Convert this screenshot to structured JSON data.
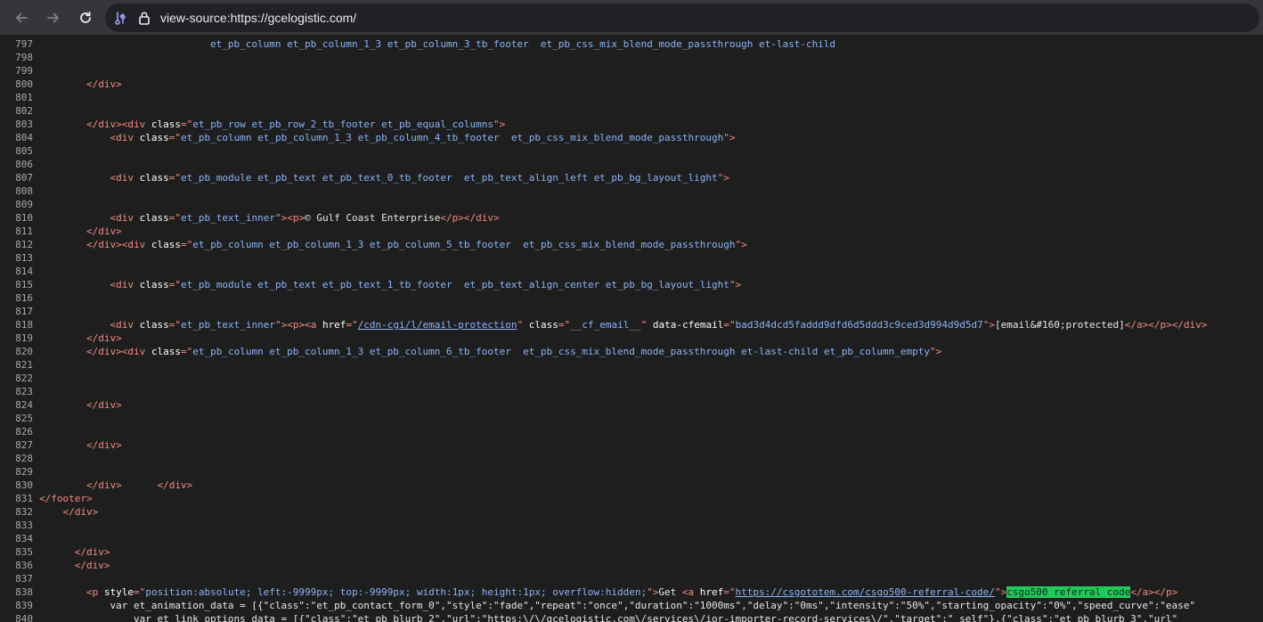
{
  "toolbar": {
    "url": "view-source:https://gcelogistic.com/",
    "buttons": [
      "back",
      "forward",
      "reload"
    ]
  },
  "source": {
    "lines": [
      {
        "n": "797",
        "t": [
          [
            "                             ",
            ""
          ],
          [
            "et_pb_column et_pb_column_1_3 et_pb_column_3_tb_footer  et_pb_css_mix_blend_mode_passthrough et-last-child",
            "v"
          ]
        ]
      },
      {
        "n": "798",
        "t": []
      },
      {
        "n": "799",
        "t": []
      },
      {
        "n": "800",
        "t": [
          [
            "        ",
            ""
          ],
          [
            "</div>",
            "t"
          ]
        ]
      },
      {
        "n": "801",
        "t": []
      },
      {
        "n": "802",
        "t": []
      },
      {
        "n": "803",
        "t": [
          [
            "        ",
            ""
          ],
          [
            "</div><div ",
            "t"
          ],
          [
            "class",
            "a"
          ],
          [
            "=\"",
            "t"
          ],
          [
            "et_pb_row et_pb_row_2_tb_footer et_pb_equal_columns",
            "v"
          ],
          [
            "\">",
            "t"
          ]
        ]
      },
      {
        "n": "804",
        "t": [
          [
            "            ",
            ""
          ],
          [
            "<div ",
            "t"
          ],
          [
            "class",
            "a"
          ],
          [
            "=\"",
            "t"
          ],
          [
            "et_pb_column et_pb_column_1_3 et_pb_column_4_tb_footer  et_pb_css_mix_blend_mode_passthrough",
            "v"
          ],
          [
            "\">",
            "t"
          ]
        ]
      },
      {
        "n": "805",
        "t": []
      },
      {
        "n": "806",
        "t": []
      },
      {
        "n": "807",
        "t": [
          [
            "            ",
            ""
          ],
          [
            "<div ",
            "t"
          ],
          [
            "class",
            "a"
          ],
          [
            "=\"",
            "t"
          ],
          [
            "et_pb_module et_pb_text et_pb_text_0_tb_footer  et_pb_text_align_left et_pb_bg_layout_light",
            "v"
          ],
          [
            "\">",
            "t"
          ]
        ]
      },
      {
        "n": "808",
        "t": []
      },
      {
        "n": "809",
        "t": []
      },
      {
        "n": "810",
        "t": [
          [
            "            ",
            ""
          ],
          [
            "<div ",
            "t"
          ],
          [
            "class",
            "a"
          ],
          [
            "=\"",
            "t"
          ],
          [
            "et_pb_text_inner",
            "v"
          ],
          [
            "\"><p>",
            "t"
          ],
          [
            "© Gulf Coast Enterprise",
            ""
          ],
          [
            "</p></div>",
            "t"
          ]
        ]
      },
      {
        "n": "811",
        "t": [
          [
            "        ",
            ""
          ],
          [
            "</div>",
            "t"
          ]
        ]
      },
      {
        "n": "812",
        "t": [
          [
            "        ",
            ""
          ],
          [
            "</div><div ",
            "t"
          ],
          [
            "class",
            "a"
          ],
          [
            "=\"",
            "t"
          ],
          [
            "et_pb_column et_pb_column_1_3 et_pb_column_5_tb_footer  et_pb_css_mix_blend_mode_passthrough",
            "v"
          ],
          [
            "\">",
            "t"
          ]
        ]
      },
      {
        "n": "813",
        "t": []
      },
      {
        "n": "814",
        "t": []
      },
      {
        "n": "815",
        "t": [
          [
            "            ",
            ""
          ],
          [
            "<div ",
            "t"
          ],
          [
            "class",
            "a"
          ],
          [
            "=\"",
            "t"
          ],
          [
            "et_pb_module et_pb_text et_pb_text_1_tb_footer  et_pb_text_align_center et_pb_bg_layout_light",
            "v"
          ],
          [
            "\">",
            "t"
          ]
        ]
      },
      {
        "n": "816",
        "t": []
      },
      {
        "n": "817",
        "t": []
      },
      {
        "n": "818",
        "t": [
          [
            "            ",
            ""
          ],
          [
            "<div ",
            "t"
          ],
          [
            "class",
            "a"
          ],
          [
            "=\"",
            "t"
          ],
          [
            "et_pb_text_inner",
            "v"
          ],
          [
            "\"><p><a ",
            "t"
          ],
          [
            "href",
            "a"
          ],
          [
            "=\"",
            "t"
          ],
          [
            "/cdn-cgi/l/email-protection",
            "l"
          ],
          [
            "\" ",
            "t"
          ],
          [
            "class",
            "a"
          ],
          [
            "=\"",
            "t"
          ],
          [
            "__cf_email__",
            "v"
          ],
          [
            "\" ",
            "t"
          ],
          [
            "data-cfemail",
            "a"
          ],
          [
            "=\"",
            "t"
          ],
          [
            "bad3d4dcd5faddd9dfd6d5ddd3c9ced3d994d9d5d7",
            "v"
          ],
          [
            "\">",
            "t"
          ],
          [
            "[email&#160;protected]",
            ""
          ],
          [
            "</a></p></div>",
            "t"
          ]
        ]
      },
      {
        "n": "819",
        "t": [
          [
            "        ",
            ""
          ],
          [
            "</div>",
            "t"
          ]
        ]
      },
      {
        "n": "820",
        "t": [
          [
            "        ",
            ""
          ],
          [
            "</div><div ",
            "t"
          ],
          [
            "class",
            "a"
          ],
          [
            "=\"",
            "t"
          ],
          [
            "et_pb_column et_pb_column_1_3 et_pb_column_6_tb_footer  et_pb_css_mix_blend_mode_passthrough et-last-child et_pb_column_empty",
            "v"
          ],
          [
            "\">",
            "t"
          ]
        ]
      },
      {
        "n": "821",
        "t": []
      },
      {
        "n": "822",
        "t": []
      },
      {
        "n": "823",
        "t": []
      },
      {
        "n": "824",
        "t": [
          [
            "        ",
            ""
          ],
          [
            "</div>",
            "t"
          ]
        ]
      },
      {
        "n": "825",
        "t": []
      },
      {
        "n": "826",
        "t": []
      },
      {
        "n": "827",
        "t": [
          [
            "        ",
            ""
          ],
          [
            "</div>",
            "t"
          ]
        ]
      },
      {
        "n": "828",
        "t": []
      },
      {
        "n": "829",
        "t": []
      },
      {
        "n": "830",
        "t": [
          [
            "        ",
            ""
          ],
          [
            "</div>",
            "t"
          ],
          [
            "      ",
            ""
          ],
          [
            "</div>",
            "t"
          ]
        ]
      },
      {
        "n": "831",
        "t": [
          [
            "",
            ""
          ],
          [
            "</footer>",
            "t"
          ]
        ]
      },
      {
        "n": "832",
        "t": [
          [
            "    ",
            ""
          ],
          [
            "</div>",
            "t"
          ]
        ]
      },
      {
        "n": "833",
        "t": []
      },
      {
        "n": "834",
        "t": []
      },
      {
        "n": "835",
        "t": [
          [
            "      ",
            ""
          ],
          [
            "</div>",
            "t"
          ]
        ]
      },
      {
        "n": "836",
        "t": [
          [
            "      ",
            ""
          ],
          [
            "</div>",
            "t"
          ]
        ]
      },
      {
        "n": "837",
        "t": []
      },
      {
        "n": "838",
        "t": [
          [
            "        ",
            ""
          ],
          [
            "<p ",
            "t"
          ],
          [
            "style",
            "a"
          ],
          [
            "=\"",
            "t"
          ],
          [
            "position:absolute; left:-9999px; top:-9999px; width:1px; height:1px; overflow:hidden;",
            "v"
          ],
          [
            "\">",
            "t"
          ],
          [
            "Get ",
            ""
          ],
          [
            "<a ",
            "t"
          ],
          [
            "href",
            "a"
          ],
          [
            "=\"",
            "t"
          ],
          [
            "https://csgototem.com/csgo500-referral-code/",
            "l"
          ],
          [
            "\">",
            "t"
          ],
          [
            "csgo500 referral code",
            "hl"
          ],
          [
            "</a></p>",
            "t"
          ]
        ]
      },
      {
        "n": "839",
        "t": [
          [
            "            ",
            ""
          ],
          [
            "var et_animation_data = [{\"class\":\"et_pb_contact_form_0\",\"style\":\"fade\",\"repeat\":\"once\",\"duration\":\"1000ms\",\"delay\":\"0ms\",\"intensity\":\"50%\",\"starting_opacity\":\"0%\",\"speed_curve\":\"ease\"",
            ""
          ]
        ]
      },
      {
        "n": "840",
        "t": [
          [
            "                ",
            ""
          ],
          [
            "var et_link_options_data = [{\"class\":\"et_pb_blurb_2\",\"url\":\"https:\\/\\/gcelogistic.com\\/services\\/ior-importer-record-services\\/\",\"target\":\"_self\"},{\"class\":\"et_pb_blurb_3\",\"url\"",
            ""
          ]
        ]
      }
    ]
  }
}
